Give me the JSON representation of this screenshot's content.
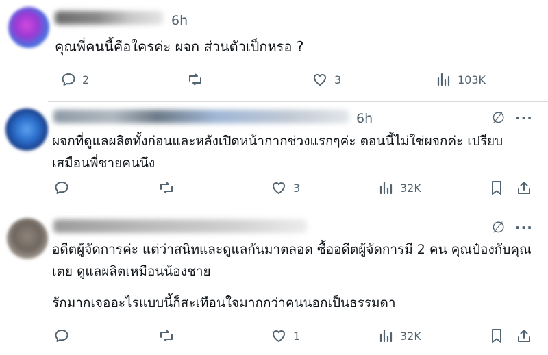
{
  "replies": [
    {
      "time": "6h",
      "text": "คุณพี่คนนี้คือใครค่ะ ผจก ส่วนตัวเป็กหรอ ?",
      "stats": {
        "replies": "2",
        "reposts": "",
        "likes": "3",
        "views": "103K"
      },
      "show_bookmark": false
    },
    {
      "time": "6h",
      "text_lines": [
        "ผจกที่ดูแลผลิตทั้งก่อนและหลังเปิดหน้ากากช่วงแรกๆค่ะ ตอนนี้ไม่ใช่ผจกค่ะ  เปรียบ",
        "เสมือนพี่ชายคนนึง"
      ],
      "stats": {
        "replies": "",
        "reposts": "",
        "likes": "3",
        "views": "32K"
      },
      "show_bookmark": true
    },
    {
      "time": "",
      "text_lines": [
        "อดีตผู้จัดการค่ะ แต่ว่าสนิทและดูแลกันมาตลอด ซื้ออดีตผู้จัดการมี 2 คน คุณป๋องกับคุณ",
        "เตย ดูแลผลิตเหมือนน้องชาย"
      ],
      "text_extra": "รักมากเจออะไรแบบนี้ก็สะเทือนใจมากกว่าคนนอกเป็นธรรมดา",
      "stats": {
        "replies": "",
        "reposts": "",
        "likes": "1",
        "views": "32K"
      },
      "show_bookmark": true
    }
  ],
  "icons": {
    "reply": "reply-icon",
    "repost": "repost-icon",
    "like": "heart-icon",
    "views": "views-icon",
    "bookmark": "bookmark-icon",
    "share": "share-icon",
    "grok": "grok-icon",
    "more": "more-icon"
  },
  "glyphs": {
    "grok": "∅",
    "more": "···"
  },
  "colors": {
    "text": "#0f1419",
    "muted": "#536471",
    "divider": "#d6dadd"
  }
}
